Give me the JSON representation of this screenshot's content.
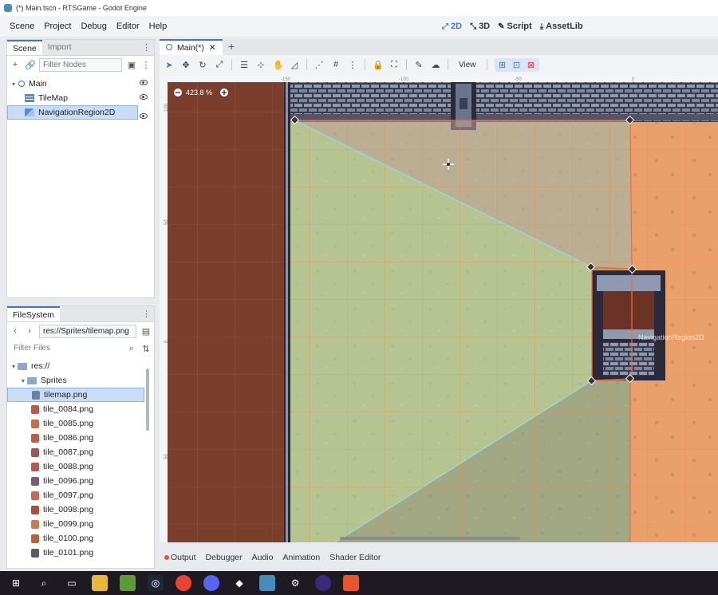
{
  "window": {
    "title": "(*) Main.tscn - RTSGame - Godot Engine"
  },
  "menu": [
    "Scene",
    "Project",
    "Debug",
    "Editor",
    "Help"
  ],
  "modes": [
    {
      "label": "2D",
      "glyph": "⤢",
      "active": true
    },
    {
      "label": "3D",
      "glyph": "⤡",
      "active": false
    },
    {
      "label": "Script",
      "glyph": "✎",
      "active": false
    },
    {
      "label": "AssetLib",
      "glyph": "⤓",
      "active": false
    }
  ],
  "scene_panel": {
    "tabs": [
      "Scene",
      "Import"
    ],
    "filter_placeholder": "Filter Nodes",
    "nodes": [
      {
        "name": "Main",
        "type": "node2d",
        "depth": 0
      },
      {
        "name": "TileMap",
        "type": "tilemap",
        "depth": 1
      },
      {
        "name": "NavigationRegion2D",
        "type": "navreg",
        "depth": 1,
        "selected": true
      }
    ]
  },
  "filesystem": {
    "tab": "FileSystem",
    "path": "res://Sprites/tilemap.png",
    "filter_placeholder": "Filter Files",
    "items": [
      {
        "name": "res://",
        "kind": "folder",
        "depth": 0
      },
      {
        "name": "Sprites",
        "kind": "folder",
        "depth": 1
      },
      {
        "name": "tilemap.png",
        "kind": "file",
        "depth": 2,
        "selected": true,
        "color": "#6a7fa3"
      },
      {
        "name": "tile_0084.png",
        "kind": "file",
        "depth": 2,
        "color": "#b9584f"
      },
      {
        "name": "tile_0085.png",
        "kind": "file",
        "depth": 2,
        "color": "#c0704b"
      },
      {
        "name": "tile_0086.png",
        "kind": "file",
        "depth": 2,
        "color": "#b76048"
      },
      {
        "name": "tile_0087.png",
        "kind": "file",
        "depth": 2,
        "color": "#9c5a50"
      },
      {
        "name": "tile_0088.png",
        "kind": "file",
        "depth": 2,
        "color": "#ad5c52"
      },
      {
        "name": "tile_0096.png",
        "kind": "file",
        "depth": 2,
        "color": "#7d5a6f"
      },
      {
        "name": "tile_0097.png",
        "kind": "file",
        "depth": 2,
        "color": "#c56b55"
      },
      {
        "name": "tile_0098.png",
        "kind": "file",
        "depth": 2,
        "color": "#a5533f"
      },
      {
        "name": "tile_0099.png",
        "kind": "file",
        "depth": 2,
        "color": "#c57a5a"
      },
      {
        "name": "tile_0100.png",
        "kind": "file",
        "depth": 2,
        "color": "#b3633f"
      },
      {
        "name": "tile_0101.png",
        "kind": "file",
        "depth": 2,
        "color": "#5b5b66"
      }
    ]
  },
  "editor": {
    "scene_tab": "Main(*)",
    "view_label": "View",
    "zoom": "423.8 %",
    "ruler_top": [
      "-150",
      "-100",
      "-50",
      "0"
    ],
    "ruler_left": [
      "100",
      "50",
      "0",
      "50"
    ],
    "node_label": "NavigationRegion2D"
  },
  "bottom_tabs": [
    "Output",
    "Debugger",
    "Audio",
    "Animation",
    "Shader Editor"
  ],
  "colors": {
    "accent": "#3d7ac4",
    "nav_fill": "#bcd08a",
    "grass": "#aab88a",
    "sand": "#e8a06a",
    "wall_brown": "#7a3e2c"
  }
}
